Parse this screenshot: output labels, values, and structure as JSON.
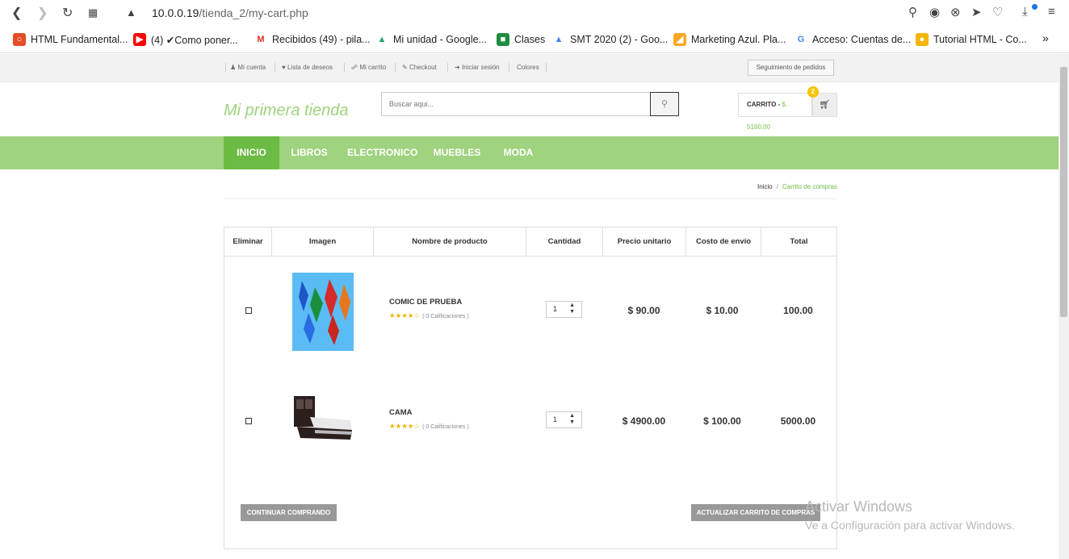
{
  "browser": {
    "url_host": "10.0.0.19",
    "url_path": "/tienda_2/my-cart.php",
    "bookmarks": [
      {
        "label": "HTML Fundamental...",
        "icon": "html-logo-icon",
        "color": "#e44d26"
      },
      {
        "label": "(4) ✔Como poner...",
        "icon": "youtube-icon",
        "color": "#ff0000"
      },
      {
        "label": "Recibidos (49) - pila...",
        "icon": "gmail-icon",
        "color": "#d93025"
      },
      {
        "label": "Mi unidad - Google...",
        "icon": "google-drive-icon",
        "color": "#1fa463"
      },
      {
        "label": "Clases",
        "icon": "google-classroom-icon",
        "color": "#1e8e3e"
      },
      {
        "label": "SMT 2020 (2) - Goo...",
        "icon": "google-drive-icon",
        "color": "#4285f4"
      },
      {
        "label": "Marketing Azul. Pla...",
        "icon": "bookmark-icon",
        "color": "#f9a825"
      },
      {
        "label": "Acceso: Cuentas de...",
        "icon": "google-g-icon",
        "color": "#4285f4"
      },
      {
        "label": "Tutorial HTML - Co...",
        "icon": "tutorial-icon",
        "color": "#f4b400"
      }
    ],
    "more": "»"
  },
  "topbar": {
    "links": [
      "Mi cuenta",
      "Lista de deseos",
      "Mi carrito",
      "Checkout",
      "Iniciar sesión",
      "Colores"
    ],
    "track": "Seguimiento de pedidos"
  },
  "header": {
    "logo": "Mi primera tienda",
    "search_placeholder": "Buscar aqui...",
    "cart_label": "CARRITO - ",
    "cart_amount": "$. 5100.00",
    "cart_count": "2"
  },
  "nav": [
    "INICIO",
    "LIBROS",
    "ELECTRONICO",
    "MUEBLES",
    "MODA"
  ],
  "breadcrumb": {
    "home": "Inicio",
    "sep": "/",
    "current": "Carrito de compras"
  },
  "table": {
    "headers": [
      "Eliminar",
      "Imagen",
      "Nombre de producto",
      "Cantidad",
      "Precio unitario",
      "Costo de envío",
      "Total"
    ],
    "rows": [
      {
        "name": "COMIC DE PRUEBA",
        "stars": "★★★★☆",
        "ratings": "( 0 Calificaciones )",
        "qty": "1",
        "unit": "$ 90.00",
        "shipping": "$ 10.00",
        "total": "100.00"
      },
      {
        "name": "CAMA",
        "stars": "★★★★☆",
        "ratings": "( 0 Calificaciones )",
        "qty": "1",
        "unit": "$ 4900.00",
        "shipping": "$ 100.00",
        "total": "5000.00"
      }
    ],
    "continue_btn": "CONTINUAR COMPRANDO",
    "update_btn": "ACTUALIZAR CARRITO DE COMPRAS"
  },
  "watermark": {
    "line1": "Activar Windows",
    "line2": "Ve a Configuración para activar Windows."
  }
}
